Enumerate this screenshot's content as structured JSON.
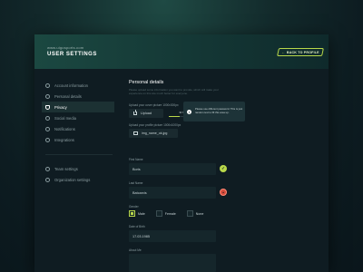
{
  "header": {
    "site_url": "www.uigosports.com",
    "title": "USER SETTINGS",
    "back_button": "BACK TO PROFILE"
  },
  "sidebar": {
    "items": [
      {
        "label": "Account information",
        "icon": "account-icon",
        "active": false
      },
      {
        "label": "Personal details",
        "icon": "person-icon",
        "active": false
      },
      {
        "label": "Privacy",
        "icon": "shield-icon",
        "active": true
      },
      {
        "label": "Social media",
        "icon": "globe-icon",
        "active": false
      },
      {
        "label": "Notifications",
        "icon": "bell-icon",
        "active": false
      },
      {
        "label": "Integrations",
        "icon": "plug-icon",
        "active": false
      }
    ],
    "bottom_items": [
      {
        "label": "Team settings",
        "icon": "team-icon"
      },
      {
        "label": "Organization settings",
        "icon": "gear-icon"
      }
    ]
  },
  "main": {
    "section_title": "Personal details",
    "description": "Please upload some information you want to provide, which will make your experience on this site much better for everyone.",
    "upload_cover_label": "Upload your cover picture 1000x300px",
    "upload_button": "Upload",
    "upload_progress": {
      "text": "30 % uploaded",
      "fraction": 0.3
    },
    "upload_profile_label": "Upload your profile picture 1000x1000px",
    "file_name": "img_name_ok.jpg",
    "tooltip": "Please use different password. This is just random text to fill this area up.",
    "first_name_label": "First Name",
    "first_name_value": "Boris",
    "last_name_label": "Last Name",
    "last_name_value": "Batcarvis",
    "gender_label": "Gender",
    "gender_options": [
      "Male",
      "Female",
      "None"
    ],
    "gender_selected": "Male",
    "dob_label": "Date of Birth",
    "dob_value": "17.03.1985",
    "about_label": "About Me"
  },
  "colors": {
    "accent": "#b9d84a",
    "error": "#d64b3b",
    "background": "#0f1c22"
  }
}
